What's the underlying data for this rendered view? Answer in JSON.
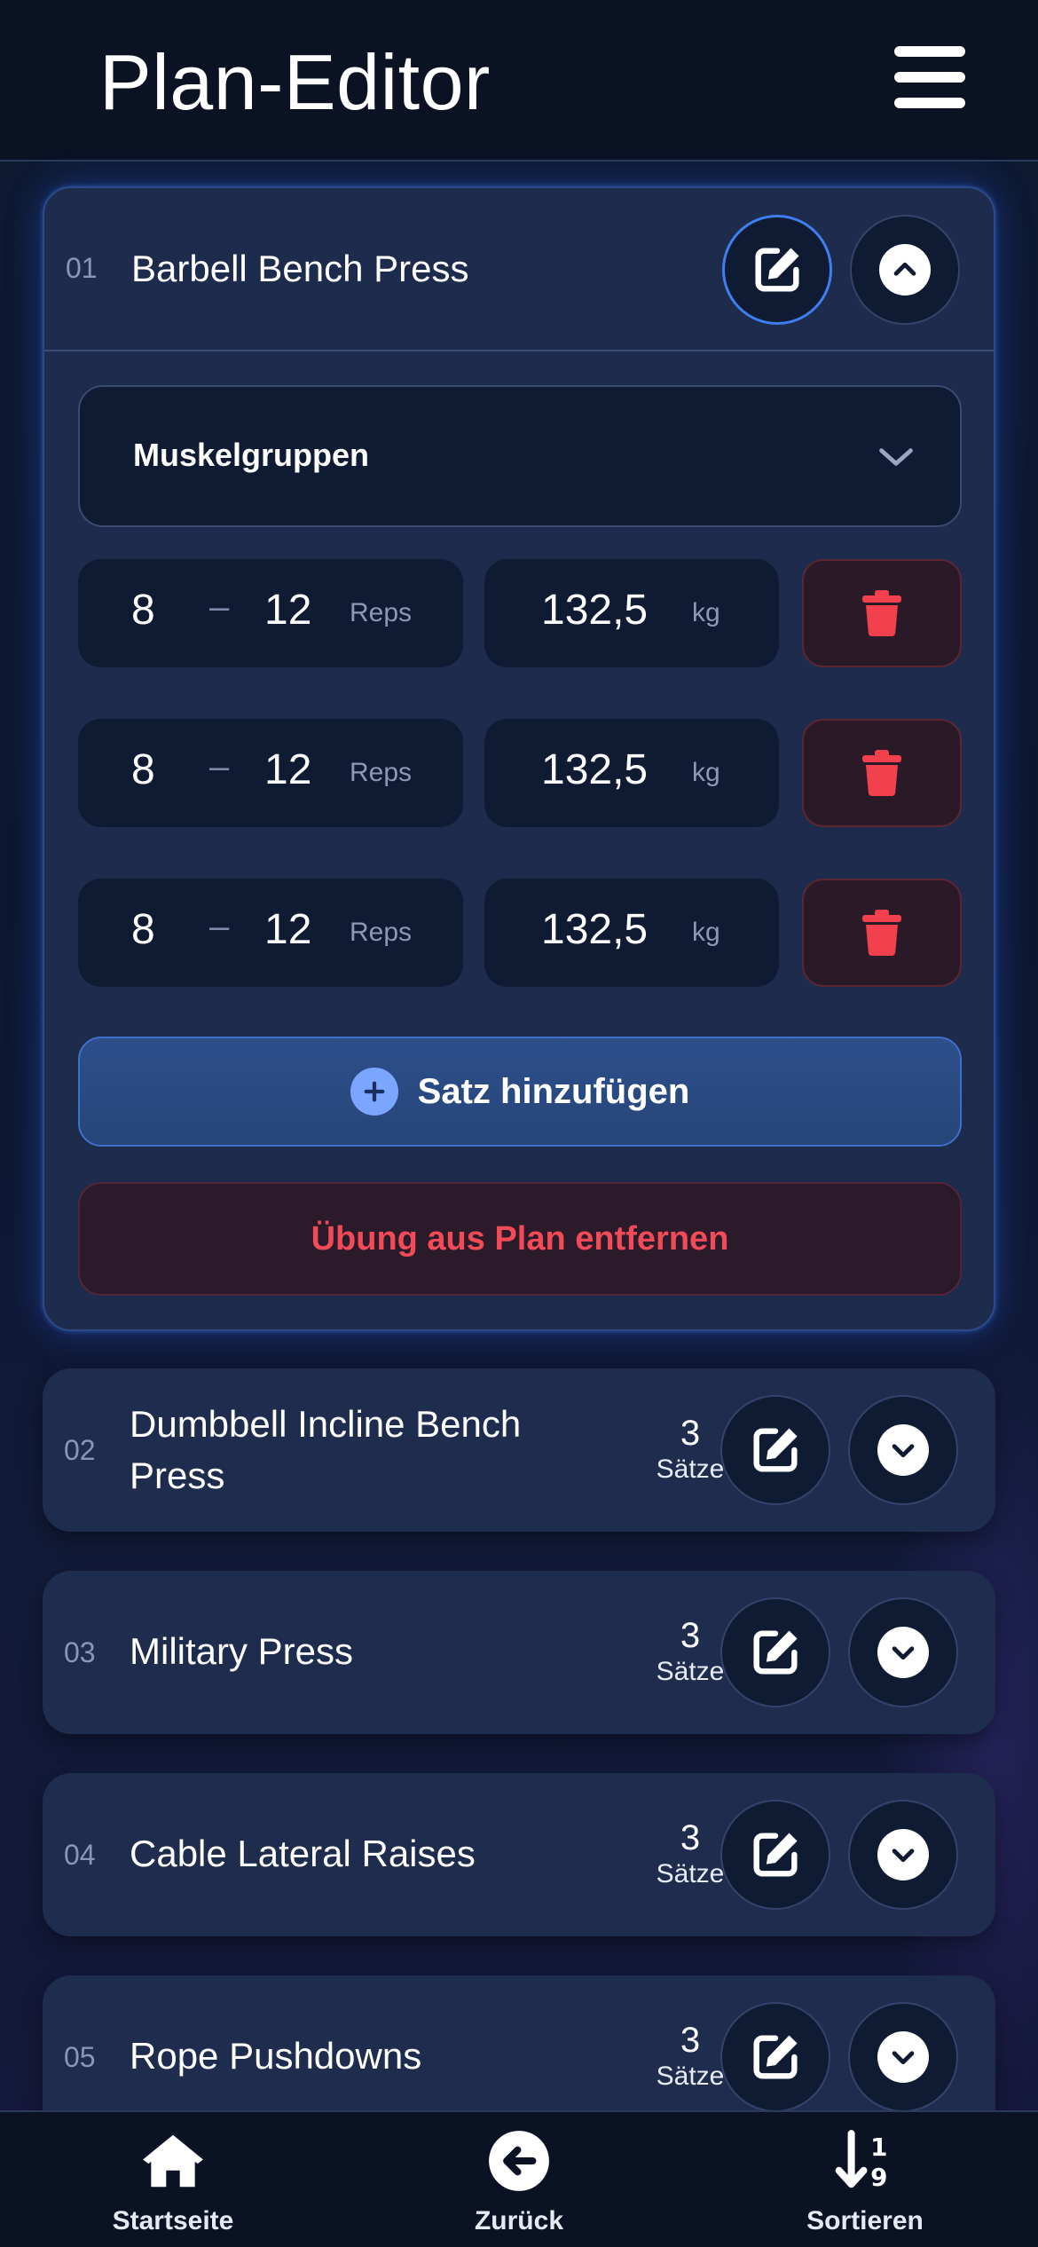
{
  "header": {
    "title": "Plan-Editor"
  },
  "expanded_exercise": {
    "index": "01",
    "name": "Barbell Bench Press",
    "muscle_select_label": "Muskelgruppen",
    "sets": [
      {
        "reps_min": "8",
        "dash": "–",
        "reps_max": "12",
        "reps_unit": "Reps",
        "weight": "132,5",
        "weight_unit": "kg"
      },
      {
        "reps_min": "8",
        "dash": "–",
        "reps_max": "12",
        "reps_unit": "Reps",
        "weight": "132,5",
        "weight_unit": "kg"
      },
      {
        "reps_min": "8",
        "dash": "–",
        "reps_max": "12",
        "reps_unit": "Reps",
        "weight": "132,5",
        "weight_unit": "kg"
      }
    ],
    "add_set_label": "Satz hinzufügen",
    "remove_label": "Übung aus Plan entfernen"
  },
  "exercises": [
    {
      "index": "02",
      "name_line1": "Dumbbell Incline Bench",
      "name_line2": "Press",
      "sets_count": "3",
      "sets_label": "Sätze"
    },
    {
      "index": "03",
      "name": "Military Press",
      "sets_count": "3",
      "sets_label": "Sätze"
    },
    {
      "index": "04",
      "name": "Cable Lateral Raises",
      "sets_count": "3",
      "sets_label": "Sätze"
    },
    {
      "index": "05",
      "name": "Rope Pushdowns",
      "sets_count": "3",
      "sets_label": "Sätze"
    }
  ],
  "bottom_nav": {
    "home_label": "Startseite",
    "back_label": "Zurück",
    "sort_label": "Sortieren"
  },
  "colors": {
    "accent_blue": "#3e7ef0",
    "danger_red": "#f24b57",
    "card_bg": "#1e2c4e",
    "input_bg": "#0f1a33"
  }
}
